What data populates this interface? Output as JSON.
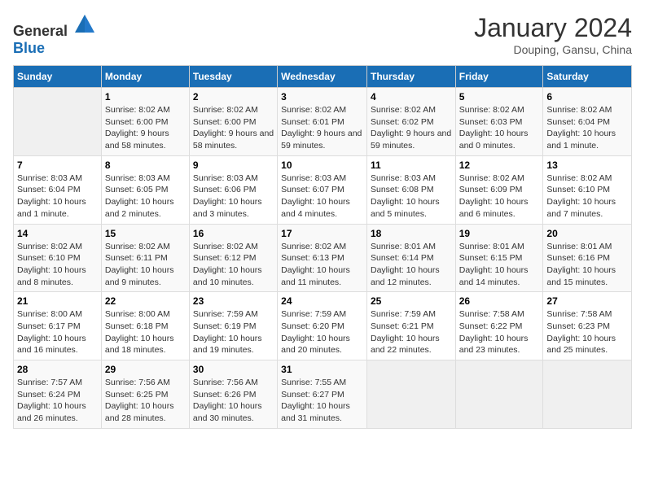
{
  "header": {
    "logo_general": "General",
    "logo_blue": "Blue",
    "title": "January 2024",
    "location": "Douping, Gansu, China"
  },
  "weekdays": [
    "Sunday",
    "Monday",
    "Tuesday",
    "Wednesday",
    "Thursday",
    "Friday",
    "Saturday"
  ],
  "weeks": [
    [
      {
        "day": "",
        "empty": true
      },
      {
        "day": "1",
        "sunrise": "8:02 AM",
        "sunset": "6:00 PM",
        "daylight": "9 hours and 58 minutes."
      },
      {
        "day": "2",
        "sunrise": "8:02 AM",
        "sunset": "6:00 PM",
        "daylight": "9 hours and 58 minutes."
      },
      {
        "day": "3",
        "sunrise": "8:02 AM",
        "sunset": "6:01 PM",
        "daylight": "9 hours and 59 minutes."
      },
      {
        "day": "4",
        "sunrise": "8:02 AM",
        "sunset": "6:02 PM",
        "daylight": "9 hours and 59 minutes."
      },
      {
        "day": "5",
        "sunrise": "8:02 AM",
        "sunset": "6:03 PM",
        "daylight": "10 hours and 0 minutes."
      },
      {
        "day": "6",
        "sunrise": "8:02 AM",
        "sunset": "6:04 PM",
        "daylight": "10 hours and 1 minute."
      }
    ],
    [
      {
        "day": "7",
        "sunrise": "8:03 AM",
        "sunset": "6:04 PM",
        "daylight": "10 hours and 1 minute."
      },
      {
        "day": "8",
        "sunrise": "8:03 AM",
        "sunset": "6:05 PM",
        "daylight": "10 hours and 2 minutes."
      },
      {
        "day": "9",
        "sunrise": "8:03 AM",
        "sunset": "6:06 PM",
        "daylight": "10 hours and 3 minutes."
      },
      {
        "day": "10",
        "sunrise": "8:03 AM",
        "sunset": "6:07 PM",
        "daylight": "10 hours and 4 minutes."
      },
      {
        "day": "11",
        "sunrise": "8:03 AM",
        "sunset": "6:08 PM",
        "daylight": "10 hours and 5 minutes."
      },
      {
        "day": "12",
        "sunrise": "8:02 AM",
        "sunset": "6:09 PM",
        "daylight": "10 hours and 6 minutes."
      },
      {
        "day": "13",
        "sunrise": "8:02 AM",
        "sunset": "6:10 PM",
        "daylight": "10 hours and 7 minutes."
      }
    ],
    [
      {
        "day": "14",
        "sunrise": "8:02 AM",
        "sunset": "6:10 PM",
        "daylight": "10 hours and 8 minutes."
      },
      {
        "day": "15",
        "sunrise": "8:02 AM",
        "sunset": "6:11 PM",
        "daylight": "10 hours and 9 minutes."
      },
      {
        "day": "16",
        "sunrise": "8:02 AM",
        "sunset": "6:12 PM",
        "daylight": "10 hours and 10 minutes."
      },
      {
        "day": "17",
        "sunrise": "8:02 AM",
        "sunset": "6:13 PM",
        "daylight": "10 hours and 11 minutes."
      },
      {
        "day": "18",
        "sunrise": "8:01 AM",
        "sunset": "6:14 PM",
        "daylight": "10 hours and 12 minutes."
      },
      {
        "day": "19",
        "sunrise": "8:01 AM",
        "sunset": "6:15 PM",
        "daylight": "10 hours and 14 minutes."
      },
      {
        "day": "20",
        "sunrise": "8:01 AM",
        "sunset": "6:16 PM",
        "daylight": "10 hours and 15 minutes."
      }
    ],
    [
      {
        "day": "21",
        "sunrise": "8:00 AM",
        "sunset": "6:17 PM",
        "daylight": "10 hours and 16 minutes."
      },
      {
        "day": "22",
        "sunrise": "8:00 AM",
        "sunset": "6:18 PM",
        "daylight": "10 hours and 18 minutes."
      },
      {
        "day": "23",
        "sunrise": "7:59 AM",
        "sunset": "6:19 PM",
        "daylight": "10 hours and 19 minutes."
      },
      {
        "day": "24",
        "sunrise": "7:59 AM",
        "sunset": "6:20 PM",
        "daylight": "10 hours and 20 minutes."
      },
      {
        "day": "25",
        "sunrise": "7:59 AM",
        "sunset": "6:21 PM",
        "daylight": "10 hours and 22 minutes."
      },
      {
        "day": "26",
        "sunrise": "7:58 AM",
        "sunset": "6:22 PM",
        "daylight": "10 hours and 23 minutes."
      },
      {
        "day": "27",
        "sunrise": "7:58 AM",
        "sunset": "6:23 PM",
        "daylight": "10 hours and 25 minutes."
      }
    ],
    [
      {
        "day": "28",
        "sunrise": "7:57 AM",
        "sunset": "6:24 PM",
        "daylight": "10 hours and 26 minutes."
      },
      {
        "day": "29",
        "sunrise": "7:56 AM",
        "sunset": "6:25 PM",
        "daylight": "10 hours and 28 minutes."
      },
      {
        "day": "30",
        "sunrise": "7:56 AM",
        "sunset": "6:26 PM",
        "daylight": "10 hours and 30 minutes."
      },
      {
        "day": "31",
        "sunrise": "7:55 AM",
        "sunset": "6:27 PM",
        "daylight": "10 hours and 31 minutes."
      },
      {
        "day": "",
        "empty": true
      },
      {
        "day": "",
        "empty": true
      },
      {
        "day": "",
        "empty": true
      }
    ]
  ]
}
